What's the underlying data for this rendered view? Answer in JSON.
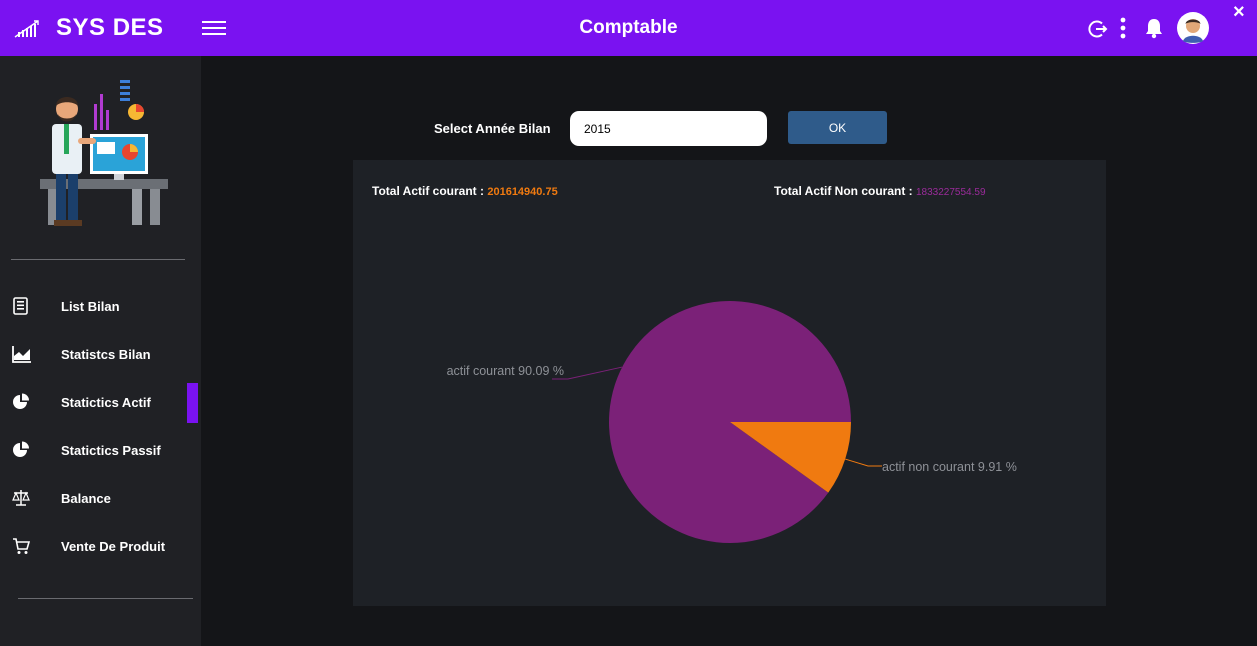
{
  "app": {
    "brand": "SYS DES",
    "title": "Comptable",
    "close_label": "×"
  },
  "colors": {
    "topbar": "#7a12f1",
    "sidebar": "#202125",
    "background": "#141518",
    "panel": "#1e2126",
    "ok_button": "#2f5b8a",
    "series_courant": "#7b2178",
    "series_non_courant": "#f07a10"
  },
  "topbar_icons": [
    "logout-icon",
    "more-vert-icon",
    "bell-icon",
    "user-avatar"
  ],
  "sidebar": {
    "items": [
      {
        "label": "List Bilan",
        "icon": "document-icon",
        "active": false
      },
      {
        "label": "Statistcs Bilan",
        "icon": "area-chart-icon",
        "active": false
      },
      {
        "label": "Statictics Actif",
        "icon": "pie-chart-icon",
        "active": true
      },
      {
        "label": "Statictics Passif",
        "icon": "pie-chart-icon",
        "active": false
      },
      {
        "label": "Balance",
        "icon": "scale-icon",
        "active": false
      },
      {
        "label": "Vente De Produit",
        "icon": "cart-icon",
        "active": false
      }
    ]
  },
  "form": {
    "select_label": "Select Année Bilan",
    "year_value": "2015",
    "ok_label": "OK"
  },
  "totals": {
    "courant_label": "Total Actif courant :",
    "courant_value": "201614940.75",
    "non_courant_label": "Total Actif Non courant :",
    "non_courant_value": "1833227554.59"
  },
  "chart_data": {
    "type": "pie",
    "title": "",
    "slices": [
      {
        "label": "actif courant 90.09 %",
        "value": 90.09,
        "color": "#7b2178"
      },
      {
        "label": "actif non courant 9.91  %",
        "value": 9.91,
        "color": "#f07a10"
      }
    ]
  }
}
